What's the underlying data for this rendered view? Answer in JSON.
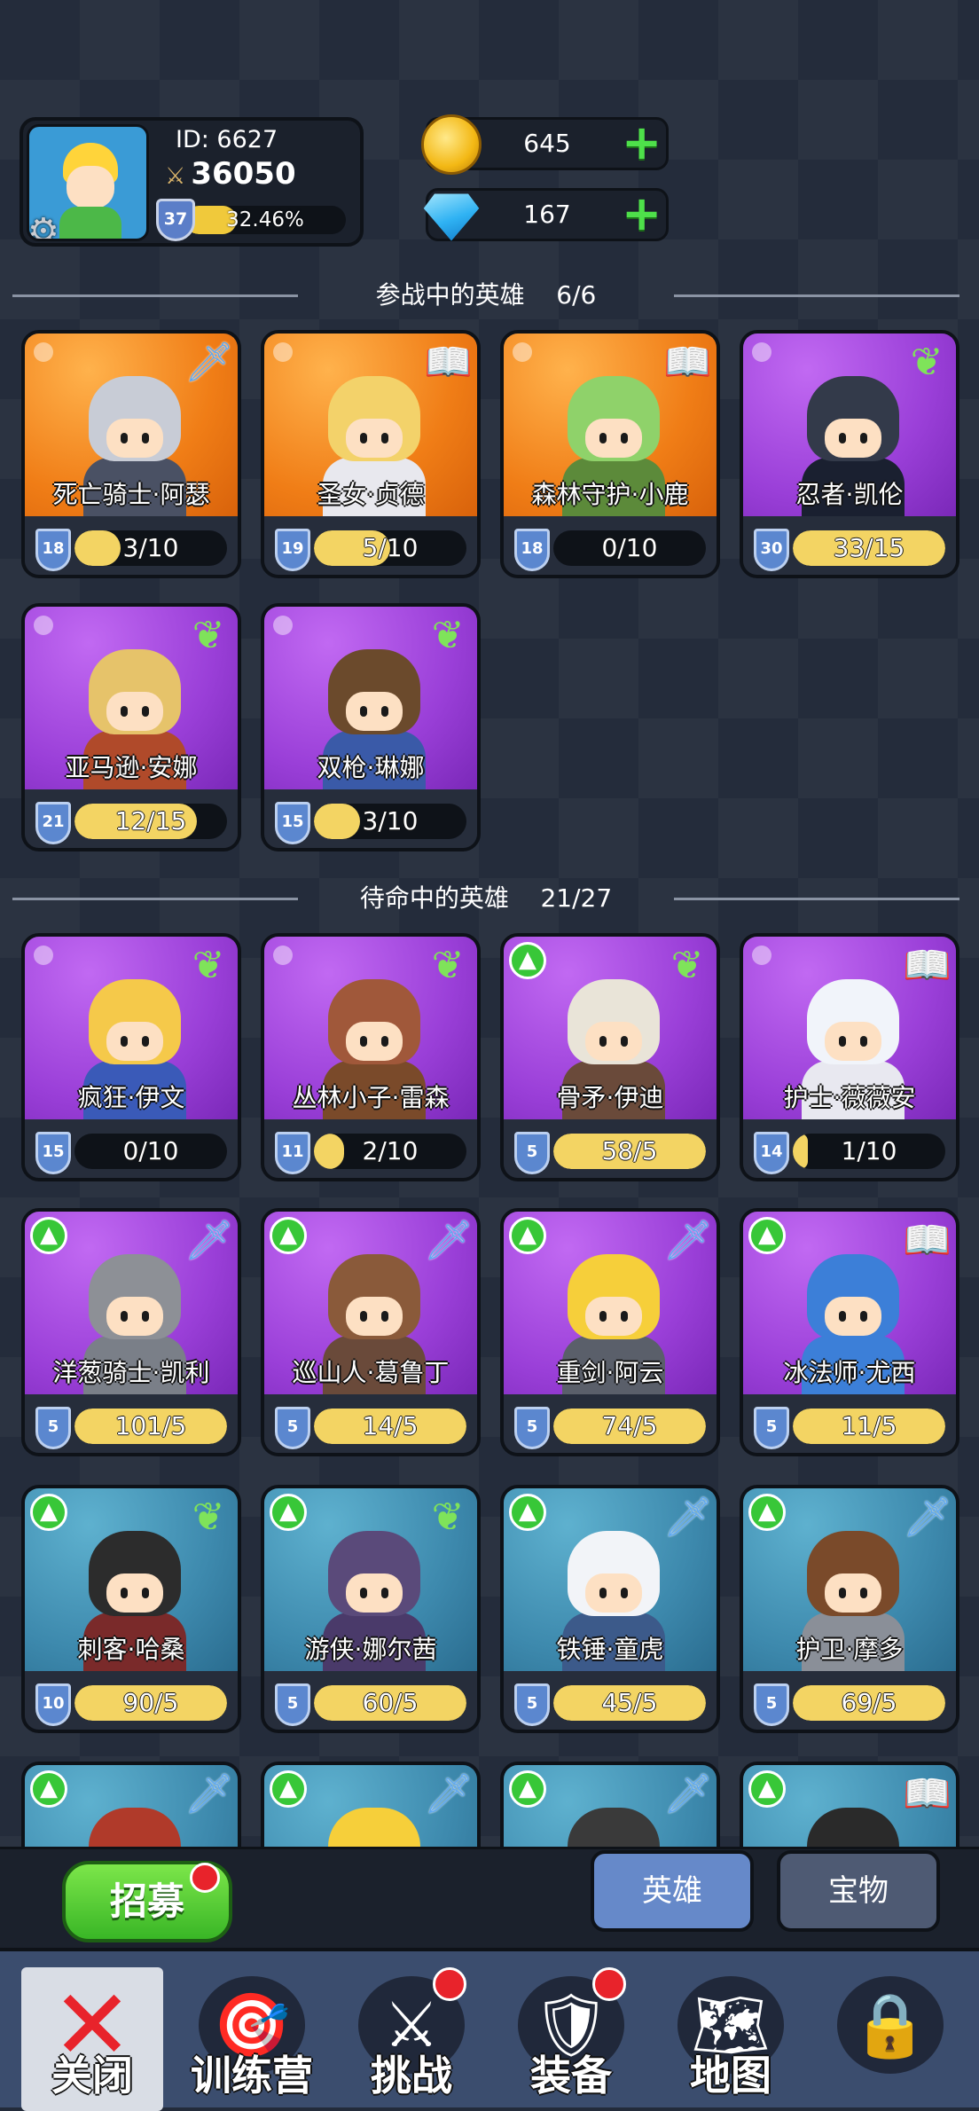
{
  "profile": {
    "id_label": "ID: 6627",
    "power": "36050",
    "level": "37",
    "exp_percent": "32.46%",
    "exp_fraction": 0.3246
  },
  "currency": {
    "gold": "645",
    "gems": "167"
  },
  "sections": {
    "active": {
      "title": "参战中的英雄",
      "count": "6/6"
    },
    "standby": {
      "title": "待命中的英雄",
      "count": "21/27"
    }
  },
  "active_heroes": [
    {
      "name": "死亡骑士·阿瑟",
      "level": "18",
      "progress": "3/10",
      "fill": 0.3,
      "rarity": "orange",
      "class_icon": "sword-icon",
      "upgrade": false
    },
    {
      "name": "圣女·贞德",
      "level": "19",
      "progress": "5/10",
      "fill": 0.5,
      "rarity": "orange",
      "class_icon": "book-icon",
      "upgrade": false
    },
    {
      "name": "森林守护·小鹿",
      "level": "18",
      "progress": "0/10",
      "fill": 0.0,
      "rarity": "orange",
      "class_icon": "book-icon",
      "upgrade": false
    },
    {
      "name": "忍者·凯伦",
      "level": "30",
      "progress": "33/15",
      "fill": 1.0,
      "rarity": "purple",
      "class_icon": "wing-icon",
      "upgrade": false
    },
    {
      "name": "亚马逊·安娜",
      "level": "21",
      "progress": "12/15",
      "fill": 0.8,
      "rarity": "purple",
      "class_icon": "wing-icon",
      "upgrade": false
    },
    {
      "name": "双枪·琳娜",
      "level": "15",
      "progress": "3/10",
      "fill": 0.3,
      "rarity": "purple",
      "class_icon": "wing-icon",
      "upgrade": false
    }
  ],
  "standby_heroes": [
    {
      "name": "疯狂·伊文",
      "level": "15",
      "progress": "0/10",
      "fill": 0.0,
      "rarity": "purple",
      "class_icon": "wing-icon",
      "upgrade": false
    },
    {
      "name": "丛林小子·雷森",
      "level": "11",
      "progress": "2/10",
      "fill": 0.2,
      "rarity": "purple",
      "class_icon": "wing-icon",
      "upgrade": false
    },
    {
      "name": "骨矛·伊迪",
      "level": "5",
      "progress": "58/5",
      "fill": 1.0,
      "rarity": "purple",
      "class_icon": "wing-icon",
      "upgrade": true
    },
    {
      "name": "护士·薇薇安",
      "level": "14",
      "progress": "1/10",
      "fill": 0.1,
      "rarity": "purple",
      "class_icon": "book-icon",
      "upgrade": false
    },
    {
      "name": "洋葱骑士·凯利",
      "level": "5",
      "progress": "101/5",
      "fill": 1.0,
      "rarity": "purple",
      "class_icon": "sword-icon",
      "upgrade": true
    },
    {
      "name": "巡山人·葛鲁丁",
      "level": "5",
      "progress": "14/5",
      "fill": 1.0,
      "rarity": "purple",
      "class_icon": "sword-icon",
      "upgrade": true
    },
    {
      "name": "重剑·阿云",
      "level": "5",
      "progress": "74/5",
      "fill": 1.0,
      "rarity": "purple",
      "class_icon": "sword-icon",
      "upgrade": true
    },
    {
      "name": "冰法师·尤西",
      "level": "5",
      "progress": "11/5",
      "fill": 1.0,
      "rarity": "purple",
      "class_icon": "book-icon",
      "upgrade": true
    },
    {
      "name": "刺客·哈桑",
      "level": "10",
      "progress": "90/5",
      "fill": 1.0,
      "rarity": "blue",
      "class_icon": "wing-icon",
      "upgrade": true
    },
    {
      "name": "游侠·娜尔茜",
      "level": "5",
      "progress": "60/5",
      "fill": 1.0,
      "rarity": "blue",
      "class_icon": "wing-icon",
      "upgrade": true
    },
    {
      "name": "铁锤·童虎",
      "level": "5",
      "progress": "45/5",
      "fill": 1.0,
      "rarity": "blue",
      "class_icon": "sword-icon",
      "upgrade": true
    },
    {
      "name": "护卫·摩多",
      "level": "5",
      "progress": "69/5",
      "fill": 1.0,
      "rarity": "blue",
      "class_icon": "sword-icon",
      "upgrade": true
    },
    {
      "name": "",
      "level": "",
      "progress": "",
      "fill": 0,
      "rarity": "blue",
      "class_icon": "sword-icon",
      "upgrade": true
    },
    {
      "name": "",
      "level": "",
      "progress": "",
      "fill": 0,
      "rarity": "blue",
      "class_icon": "sword-icon",
      "upgrade": true
    },
    {
      "name": "",
      "level": "",
      "progress": "",
      "fill": 0,
      "rarity": "blue",
      "class_icon": "sword-icon",
      "upgrade": true
    },
    {
      "name": "",
      "level": "",
      "progress": "",
      "fill": 0,
      "rarity": "blue",
      "class_icon": "book-icon",
      "upgrade": true
    }
  ],
  "actions": {
    "recruit": "招募",
    "tab_heroes": "英雄",
    "tab_treasure": "宝物"
  },
  "nav": [
    {
      "label": "关闭",
      "icon": "close-icon",
      "badge": false
    },
    {
      "label": "训练营",
      "icon": "target-icon",
      "badge": false
    },
    {
      "label": "挑战",
      "icon": "shield-sword-icon",
      "badge": true
    },
    {
      "label": "装备",
      "icon": "armor-icon",
      "badge": true
    },
    {
      "label": "地图",
      "icon": "map-icon",
      "badge": false
    },
    {
      "label": "",
      "icon": "lock-icon",
      "badge": false
    }
  ]
}
